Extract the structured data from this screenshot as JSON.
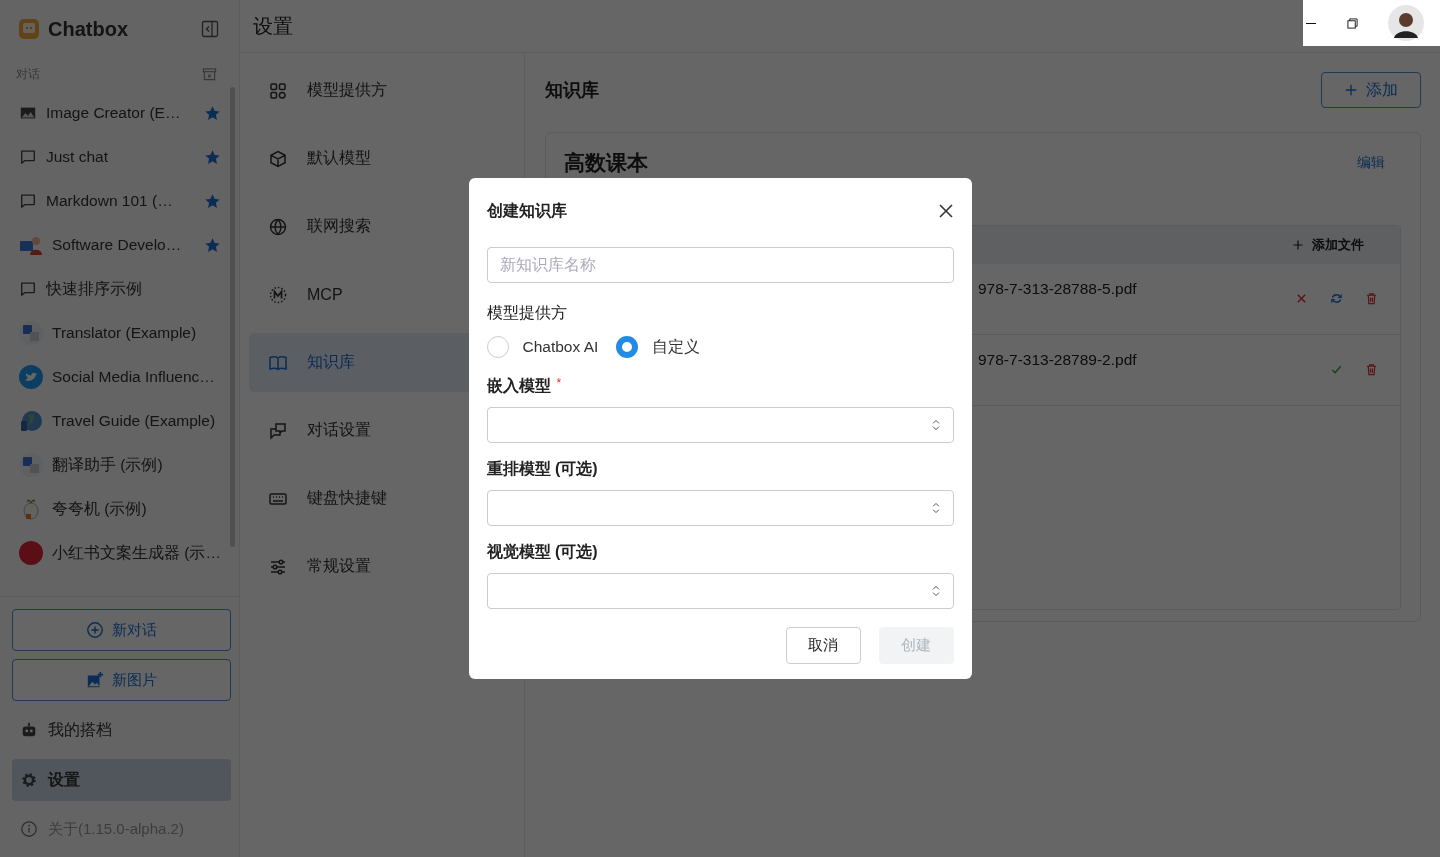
{
  "app": {
    "name": "Chatbox"
  },
  "sidebar": {
    "section_label": "对话",
    "conversations": [
      {
        "title": "Image Creator (E…",
        "starred": true
      },
      {
        "title": "Just chat",
        "starred": true
      },
      {
        "title": "Markdown 101 (…",
        "starred": true
      },
      {
        "title": "Software Develo…",
        "starred": true
      },
      {
        "title": "快速排序示例",
        "starred": false
      },
      {
        "title": "Translator (Example)",
        "starred": false
      },
      {
        "title": "Social Media Influenc…",
        "starred": false
      },
      {
        "title": "Travel Guide (Example)",
        "starred": false
      },
      {
        "title": "翻译助手 (示例)",
        "starred": false
      },
      {
        "title": "夸夸机 (示例)",
        "starred": false
      },
      {
        "title": "小红书文案生成器 (示…",
        "starred": false
      }
    ],
    "new_chat_button": "新对话",
    "new_image_button": "新图片",
    "nav": [
      {
        "label": "我的搭档",
        "selected": false
      },
      {
        "label": "设置",
        "selected": true
      }
    ],
    "about": "关于(1.15.0-alpha.2)"
  },
  "page_title": "设置",
  "settings_nav": [
    {
      "label": "模型提供方",
      "selected": false
    },
    {
      "label": "默认模型",
      "selected": false
    },
    {
      "label": "联网搜索",
      "selected": false
    },
    {
      "label": "MCP",
      "selected": false
    },
    {
      "label": "知识库",
      "selected": true
    },
    {
      "label": "对话设置",
      "selected": false
    },
    {
      "label": "键盘快捷键",
      "selected": false
    },
    {
      "label": "常规设置",
      "selected": false
    }
  ],
  "knowledge": {
    "title": "知识库",
    "add_button": "添加",
    "bases": [
      {
        "name": "高数课本",
        "edit": "编辑",
        "add_file": "添加文件",
        "files": [
          {
            "name": "978-7-313-28788-5.pdf",
            "kind": "failed"
          },
          {
            "name": "978-7-313-28789-2.pdf",
            "kind": "done"
          }
        ]
      }
    ]
  },
  "dialog": {
    "title": "创建知识库",
    "name_field": {
      "placeholder": "新知识库名称"
    },
    "provider_label": "模型提供方",
    "providers": [
      {
        "label": "Chatbox AI",
        "selected": false
      },
      {
        "label": "自定义",
        "selected": true
      }
    ],
    "selects": [
      {
        "label": "嵌入模型",
        "required_mark": "*"
      },
      {
        "label": "重排模型 (可选)"
      },
      {
        "label": "视觉模型 (可选)"
      }
    ],
    "buttons": [
      {
        "label": "取消",
        "disabled": false
      },
      {
        "label": "创建",
        "disabled": true
      }
    ]
  }
}
